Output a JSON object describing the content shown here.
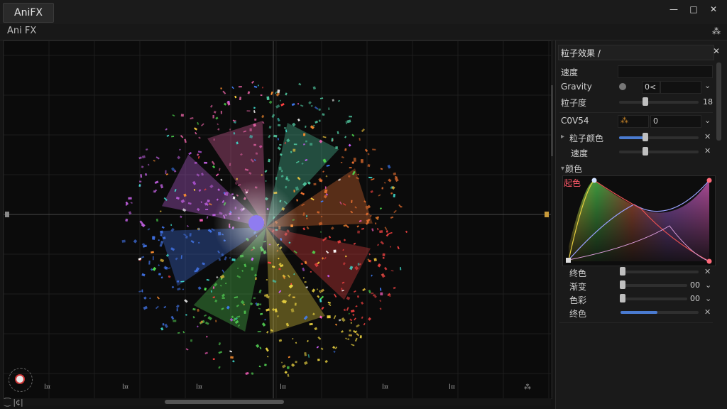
{
  "window": {
    "app_tab": "AniFX",
    "subtitle": "Ani FX",
    "controls": {
      "minimize": "—",
      "maximize": "□",
      "close": "✕"
    },
    "sub_icon": "⁂"
  },
  "viewport": {
    "ticks": [
      "l¤",
      "l¤",
      "l¤",
      "l¤",
      "l¤",
      "l¤",
      "⁂"
    ],
    "bottom_left": "⁐ |¢|"
  },
  "panel": {
    "title": "粒子效果 /",
    "close": "✕",
    "rows": [
      {
        "label": "速度",
        "value": ""
      },
      {
        "label": "Gravity",
        "value": "0<"
      },
      {
        "label": "粒子度",
        "value": "18"
      },
      {
        "label": "C0V54",
        "value": "0"
      },
      {
        "label": "粒子颜色",
        "value": ""
      },
      {
        "label": "速度",
        "value": ""
      },
      {
        "label": "颜色",
        "value": ""
      },
      {
        "label": "起色",
        "value": ""
      }
    ],
    "bottom_rows": [
      {
        "label": "终色",
        "value": ""
      },
      {
        "label": "渐变",
        "value": "00"
      },
      {
        "label": "色彩",
        "value": "00"
      },
      {
        "label": "终色",
        "value": ""
      }
    ],
    "colors": {
      "accent": "#4a7bd0",
      "curve_red": "#e85050",
      "curve_green": "#60d060",
      "curve_purple": "#b070e0"
    }
  }
}
